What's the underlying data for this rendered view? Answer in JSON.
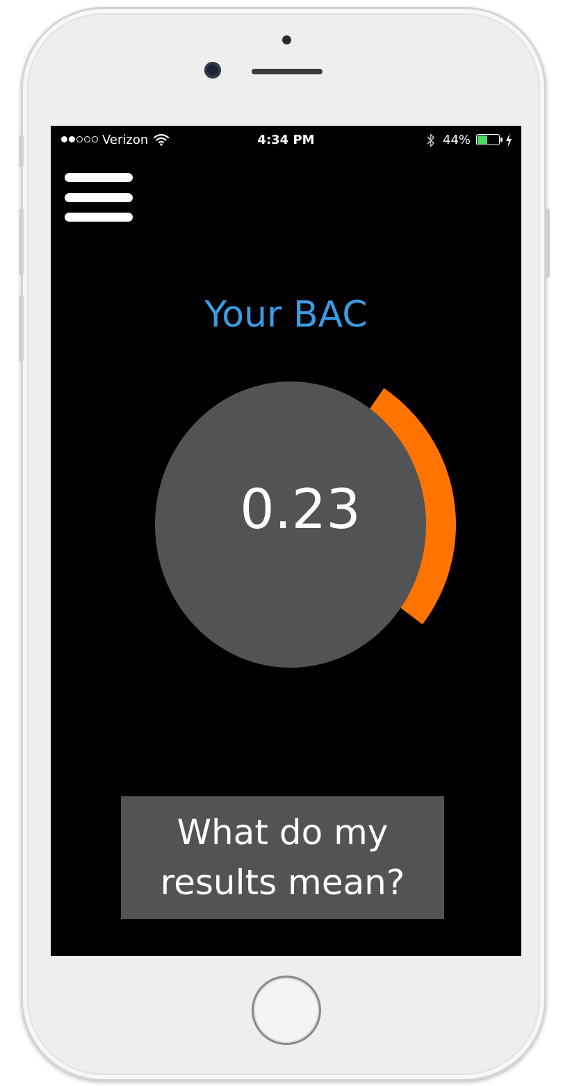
{
  "status_bar": {
    "carrier": "Verizon",
    "signal_bars": 2,
    "signal_total": 5,
    "time": "4:34 PM",
    "battery_percent": "44%",
    "battery_level": 0.44,
    "icons": [
      "wifi-icon",
      "bluetooth-icon",
      "battery-icon",
      "charging-icon"
    ]
  },
  "menu": {
    "icon": "hamburger-menu-icon"
  },
  "main": {
    "title": "Your BAC",
    "bac_value": "0.23",
    "gauge_level": 0.23
  },
  "results_button": {
    "label_line1": "What do my",
    "label_line2": "results mean?"
  },
  "colors": {
    "title": "#3b9ce4",
    "gauge_arc": "#ff7400",
    "gauge_circle": "#525354",
    "button_bg": "#525354",
    "screen_bg": "#000000",
    "battery": "#4cd964"
  }
}
